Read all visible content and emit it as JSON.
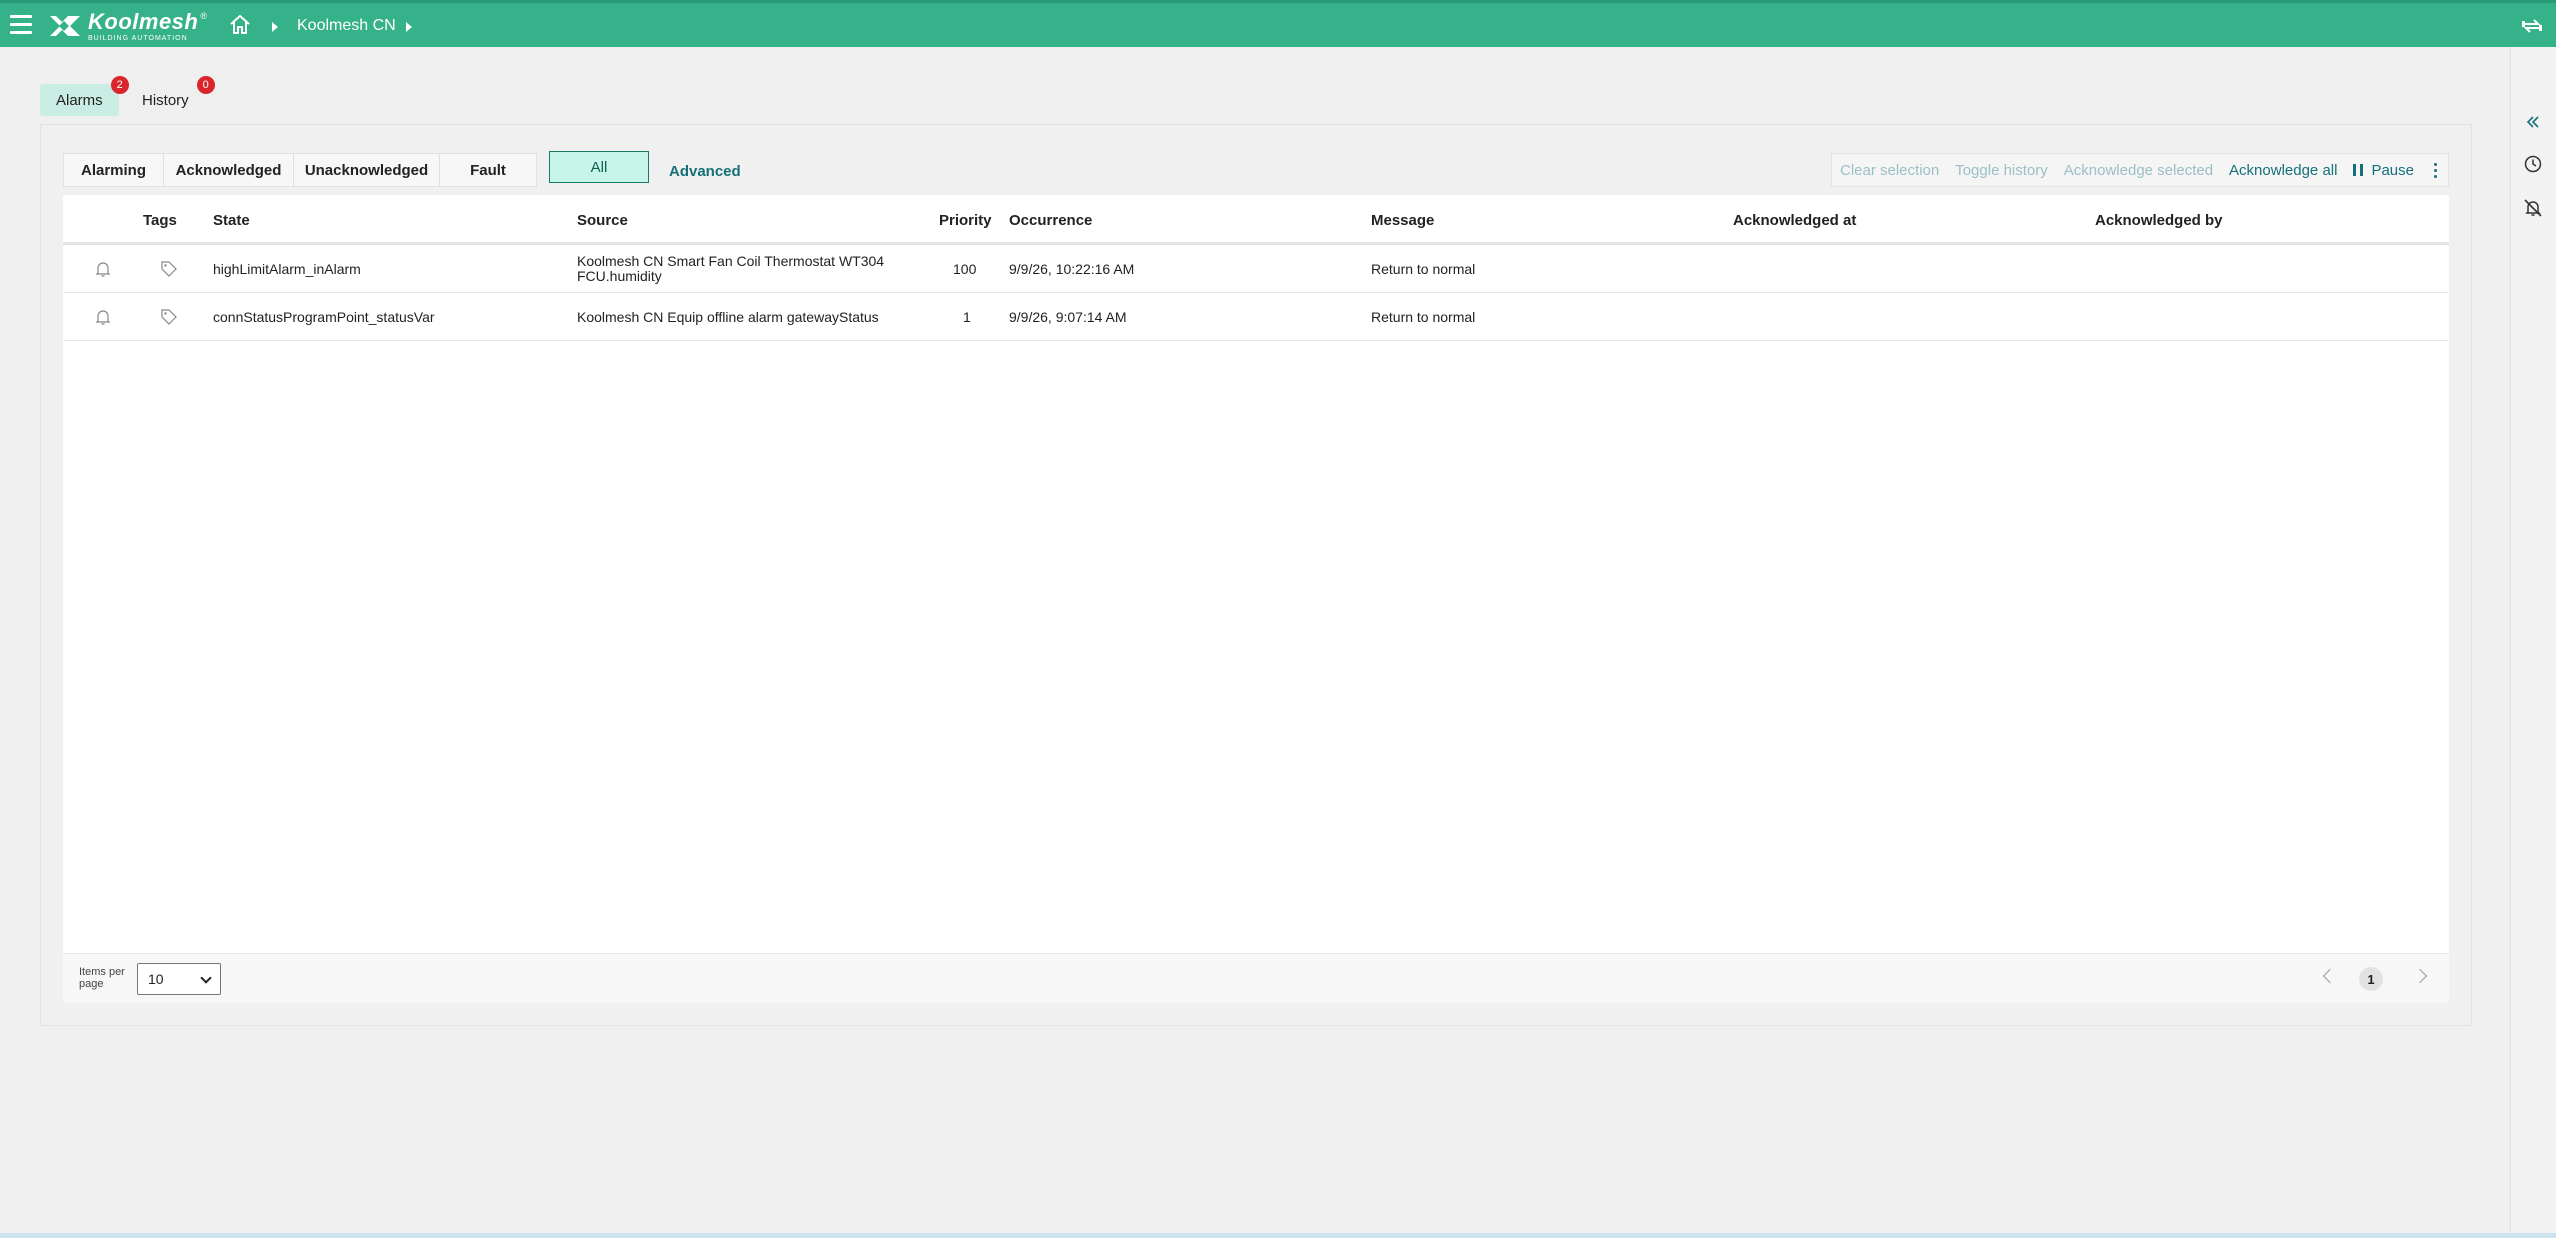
{
  "header": {
    "brand": "Koolmesh",
    "tagline": "BUILDING AUTOMATION",
    "registered": "®",
    "breadcrumb": "Koolmesh CN"
  },
  "tabs": [
    {
      "label": "Alarms",
      "badge": "2"
    },
    {
      "label": "History",
      "badge": "0"
    }
  ],
  "filters": {
    "group": [
      "Alarming",
      "Acknowledged",
      "Unacknowledged",
      "Fault"
    ],
    "all": "All",
    "advanced": "Advanced"
  },
  "actions": {
    "clear_selection": "Clear selection",
    "toggle_history": "Toggle history",
    "acknowledge_selected": "Acknowledge selected",
    "acknowledge_all": "Acknowledge all",
    "pause": "Pause"
  },
  "table": {
    "columns": {
      "tags": "Tags",
      "state": "State",
      "source": "Source",
      "priority": "Priority",
      "occurrence": "Occurrence",
      "message": "Message",
      "acknowledged_at": "Acknowledged at",
      "acknowledged_by": "Acknowledged by"
    },
    "rows": [
      {
        "state": "highLimitAlarm_inAlarm",
        "source": "Koolmesh CN Smart Fan Coil Thermostat WT304 FCU.humidity",
        "priority": "100",
        "occurrence": "9/9/26, 10:22:16 AM",
        "message": "Return to normal",
        "acknowledged_at": "",
        "acknowledged_by": ""
      },
      {
        "state": "connStatusProgramPoint_statusVar",
        "source": "Koolmesh CN Equip offline alarm gatewayStatus",
        "priority": "1",
        "occurrence": "9/9/26, 9:07:14 AM",
        "message": "Return to normal",
        "acknowledged_at": "",
        "acknowledged_by": ""
      }
    ]
  },
  "footer": {
    "items_per_page_label": "Items per page",
    "items_per_page_value": "10",
    "current_page": "1"
  },
  "colors": {
    "topbar": "#36b28a",
    "accent": "#14707a",
    "badge": "#d9262c",
    "active_tab": "#c9ece3",
    "active_filter": "#c7f5ea"
  }
}
